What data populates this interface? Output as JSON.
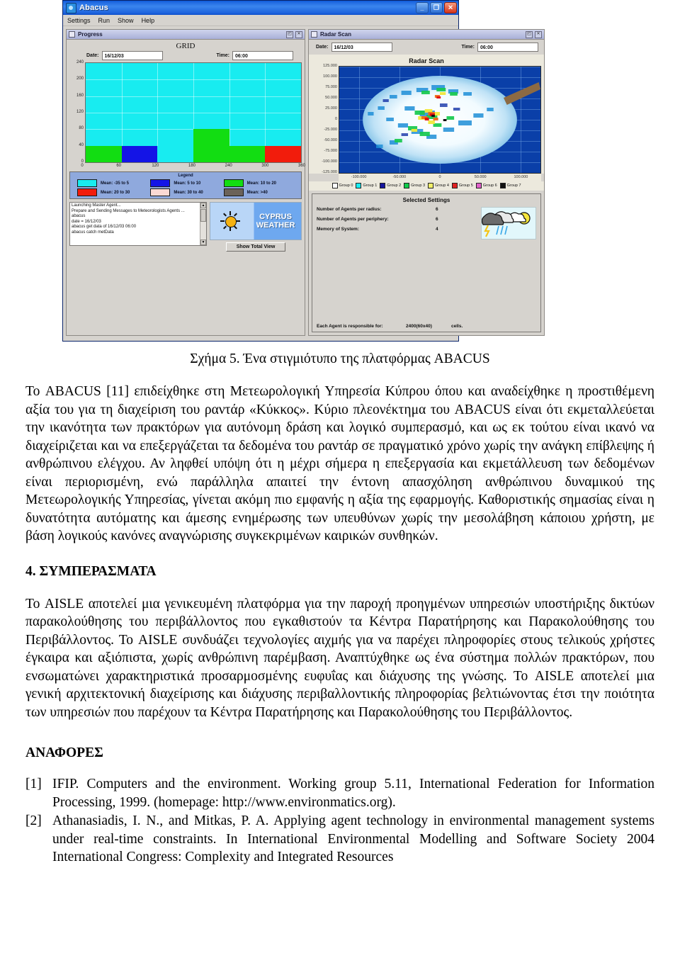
{
  "app": {
    "title": "Abacus",
    "window_buttons": [
      "minimize",
      "maximize",
      "close"
    ],
    "menu": [
      "Settings",
      "Run",
      "Show",
      "Help"
    ],
    "progress_panel": {
      "header": "Progress",
      "chart_title": "GRID",
      "date_label": "Date:",
      "date_value": "16/12/03",
      "time_label": "Time:",
      "time_value": "06:00",
      "legend_title": "Legend",
      "legend": [
        {
          "label": "Mean: -35 to 5",
          "color": "#18ecf0"
        },
        {
          "label": "Mean: 5 to 10",
          "color": "#1414e6"
        },
        {
          "label": "Mean: 10 to 20",
          "color": "#12dd12"
        },
        {
          "label": "Mean: 20 to 30",
          "color": "#f21c0c"
        },
        {
          "label": "Mean: 30 to 40",
          "color": "#fbd9d4"
        },
        {
          "label": "Mean: >40",
          "color": "#6b6259"
        }
      ],
      "console_lines": [
        "Launching Master Agent...",
        "Prepare and Sending Messages to Meteorologists Agents ...",
        "abacus",
        "date = 16/12/03",
        "abacus get data of 16/12/03 06:00",
        "abacus catch metData"
      ],
      "logo_line1": "CYPRUS",
      "logo_line2": "WEATHER",
      "total_view_button": "Show Total View"
    },
    "radar_panel": {
      "header": "Radar Scan",
      "chart_title": "Radar Scan",
      "date_label": "Date:",
      "date_value": "16/12/03",
      "time_label": "Time:",
      "time_value": "06:00",
      "groups": [
        {
          "label": "Group 0",
          "color": "#ffffff"
        },
        {
          "label": "Group 1",
          "color": "#18ecf0"
        },
        {
          "label": "Group 2",
          "color": "#16169e"
        },
        {
          "label": "Group 3",
          "color": "#12cc4a"
        },
        {
          "label": "Group 4",
          "color": "#f2f06a"
        },
        {
          "label": "Group 5",
          "color": "#e02020"
        },
        {
          "label": "Group 6",
          "color": "#e060c8"
        },
        {
          "label": "Group 7",
          "color": "#111111"
        }
      ]
    },
    "settings_panel": {
      "title": "Selected Settings",
      "rows": [
        {
          "label": "Number of Agents per radius:",
          "value": "6"
        },
        {
          "label": "Number of Agents  per periphery:",
          "value": "6"
        },
        {
          "label": "Memory of System:",
          "value": "4"
        }
      ],
      "footer_label": "Each Agent is responsible for:",
      "footer_value": "2400(60x40)",
      "footer_unit": "cells."
    }
  },
  "chart_data": [
    {
      "type": "heatmap",
      "title": "GRID",
      "xlabel": "",
      "ylabel": "",
      "xticks": [
        0,
        60,
        120,
        180,
        240,
        300,
        360
      ],
      "yticks": [
        0,
        40,
        80,
        120,
        160,
        200,
        240
      ],
      "xlim": [
        0,
        360
      ],
      "ylim": [
        0,
        240
      ],
      "grid": true,
      "background_color": "#18ecf0",
      "cells": [
        {
          "x0": 0,
          "y0": 0,
          "x1": 60,
          "y1": 40,
          "color": "#12dd12",
          "category": "Mean: 10 to 20"
        },
        {
          "x0": 60,
          "y0": 0,
          "x1": 120,
          "y1": 40,
          "color": "#1414e6",
          "category": "Mean: 5 to 10"
        },
        {
          "x0": 120,
          "y0": 0,
          "x1": 180,
          "y1": 40,
          "color": "#18ecf0",
          "category": "Mean: -35 to 5"
        },
        {
          "x0": 180,
          "y0": 0,
          "x1": 240,
          "y1": 40,
          "color": "#12dd12",
          "category": "Mean: 10 to 20"
        },
        {
          "x0": 240,
          "y0": 0,
          "x1": 300,
          "y1": 40,
          "color": "#12dd12",
          "category": "Mean: 10 to 20"
        },
        {
          "x0": 300,
          "y0": 0,
          "x1": 360,
          "y1": 40,
          "color": "#f21c0c",
          "category": "Mean: 20 to 30"
        },
        {
          "x0": 180,
          "y0": 40,
          "x1": 240,
          "y1": 80,
          "color": "#12dd12",
          "category": "Mean: 10 to 20"
        }
      ],
      "legend_position": "below",
      "legend": [
        "Mean: -35 to 5",
        "Mean: 5 to 10",
        "Mean: 10 to 20",
        "Mean: 20 to 30",
        "Mean: 30 to 40",
        "Mean: >40"
      ]
    },
    {
      "type": "scatter",
      "title": "Radar Scan",
      "xlabel": "",
      "ylabel": "",
      "xticks": [
        "-100.000",
        "-50.000",
        "0",
        "50.000",
        "100.000"
      ],
      "yticks": [
        "125.000",
        "100.000",
        "75.000",
        "50.000",
        "25.000",
        "0",
        "-25.000",
        "-50.000",
        "-75.000",
        "-100.000",
        "-125.000"
      ],
      "xlim": [
        -125000,
        125000
      ],
      "ylim": [
        -125000,
        125000
      ],
      "grid": true,
      "background_color": "#0a3fa8",
      "legend_position": "below",
      "legend": [
        "Group 0",
        "Group 1",
        "Group 2",
        "Group 3",
        "Group 4",
        "Group 5",
        "Group 6",
        "Group 7"
      ]
    }
  ],
  "document": {
    "figure_caption": "Σχήμα 5. Ένα στιγμιότυπο της πλατφόρμας ABACUS",
    "paragraph1": "Το ABACUS [11] επιδείχθηκε στη Μετεωρολογική Υπηρεσία Κύπρου όπου και αναδείχθηκε η προστιθέμενη αξία του για τη διαχείριση του ραντάρ «Κύκκος».  Κύριο πλεονέκτημα του ABACUS είναι ότι εκμεταλλεύεται την ικανότητα των πρακτόρων για αυτόνομη δράση και λογικό συμπερασμό, και ως εκ τούτου είναι ικανό να διαχείριζεται και να επεξεργάζεται τα δεδομένα του ραντάρ σε πραγματικό χρόνο χωρίς την ανάγκη επίβλεψης ή ανθρώπινου ελέγχου. Αν ληφθεί υπόψη ότι η μέχρι σήμερα η επεξεργασία και εκμετάλλευση των δεδομένων είναι περιορισμένη, ενώ παράλληλα απαιτεί την έντονη απασχόληση ανθρώπινου δυναμικού της Μετεωρολογικής Υπηρεσίας, γίνεται ακόμη πιο εμφανής η αξία της εφαρμογής. Καθοριστικής σημασίας είναι η δυνατότητα αυτόματης και άμεσης  ενημέρωσης των υπευθύνων χωρίς την μεσολάβηση κάποιου χρήστη, με βάση λογικούς κανόνες αναγνώρισης συγκεκριμένων καιρικών συνθηκών.",
    "section_heading": "4. ΣΥΜΠΕΡΑΣΜΑΤΑ",
    "paragraph2": "Το AISLE αποτελεί μια γενικευμένη πλατφόρμα για την παροχή προηγμένων υπηρεσιών υποστήριξης δικτύων παρακολούθησης του περιβάλλοντος που εγκαθιστούν τα Κέντρα Παρατήρησης και Παρακολούθησης του Περιβάλλοντος. Το AISLE συνδυάζει τεχνολογίες αιχμής για να παρέχει πληροφορίες στους τελικούς χρήστες έγκαιρα και αξιόπιστα, χωρίς ανθρώπινη παρέμβαση. Αναπτύχθηκε ως ένα σύστημα πολλών πρακτόρων, που ενσωματώνει χαρακτηριστικά προσαρμοσμένης ευφυΐας και διάχυσης της γνώσης. Το AISLE αποτελεί μια γενική αρχιτεκτονική διαχείρισης και διάχυσης περιβαλλοντικής πληροφορίας βελτιώνοντας έτσι την ποιότητα των υπηρεσιών που παρέχουν τα Κέντρα Παρατήρησης και Παρακολούθησης του Περιβάλλοντος.",
    "references_heading": "ΑΝΑΦΟΡΕΣ",
    "references": [
      {
        "num": "[1]",
        "text": "IFIP. Computers and the environment. Working group 5.11, International Federation for Information Processing, 1999. (homepage: http://www.environmatics.org)."
      },
      {
        "num": "[2]",
        "text": "Athanasiadis, I. N., and Mitkas, P. A. Applying agent technology in environmental management systems under real-time constraints. In International Environmental Modelling and Software Society 2004 International Congress: Complexity and Integrated Resources"
      }
    ]
  }
}
